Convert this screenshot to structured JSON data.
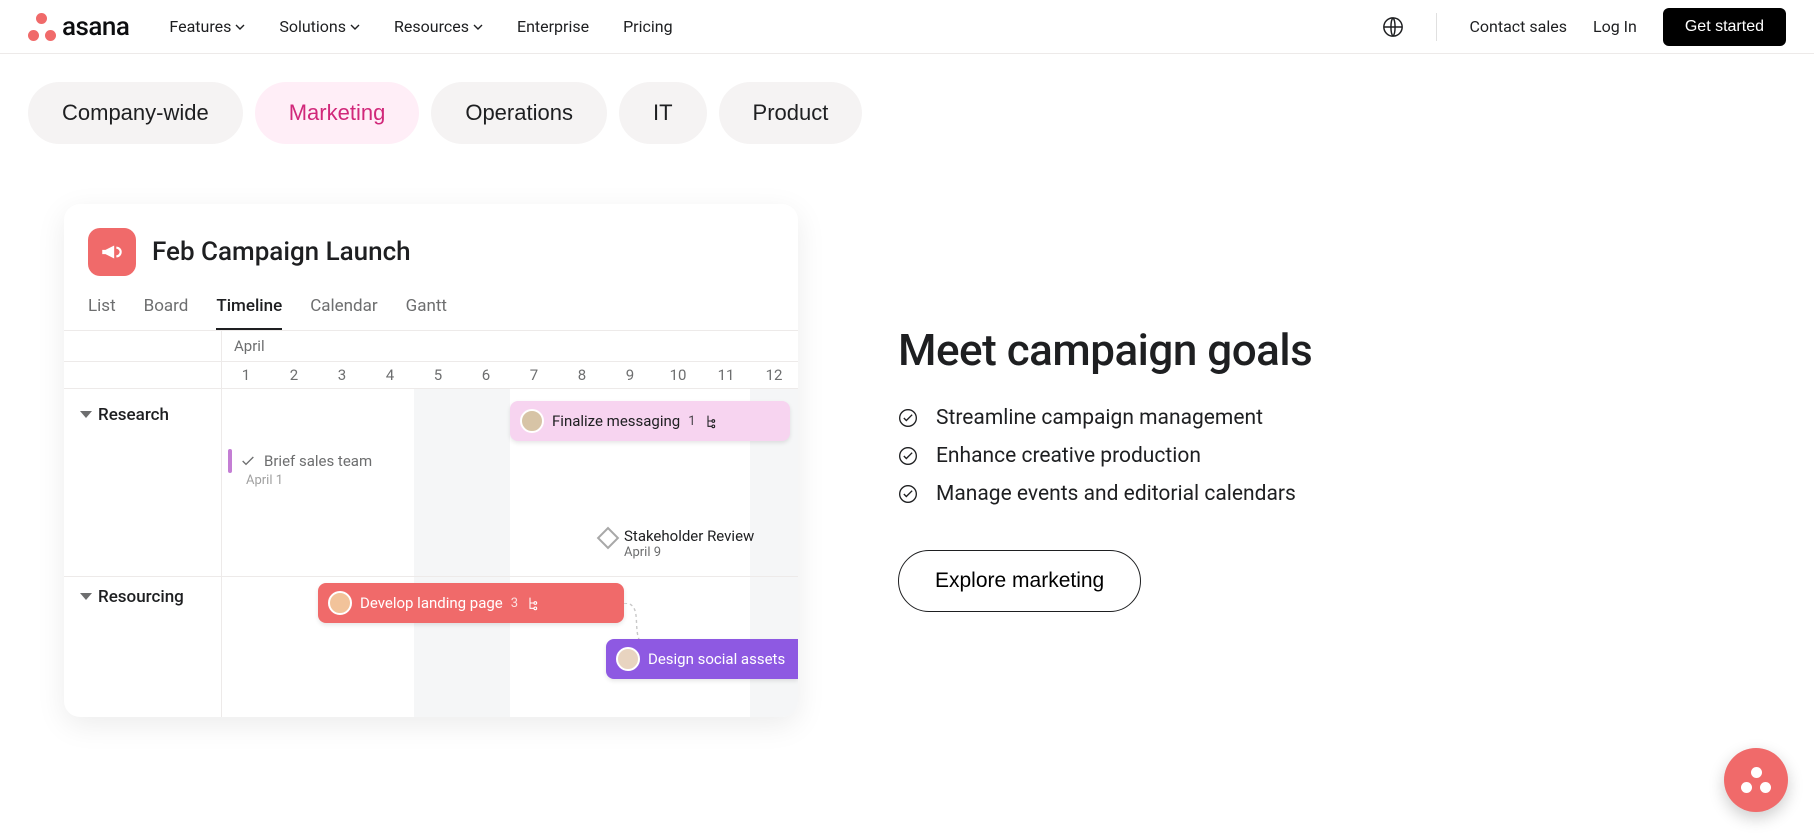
{
  "brand": {
    "name": "asana"
  },
  "nav": {
    "items": [
      {
        "label": "Features",
        "has_chevron": true
      },
      {
        "label": "Solutions",
        "has_chevron": true
      },
      {
        "label": "Resources",
        "has_chevron": true
      },
      {
        "label": "Enterprise",
        "has_chevron": false
      },
      {
        "label": "Pricing",
        "has_chevron": false
      }
    ],
    "contact_sales": "Contact sales",
    "log_in": "Log In",
    "get_started": "Get started"
  },
  "tabs": [
    {
      "label": "Company-wide",
      "active": false
    },
    {
      "label": "Marketing",
      "active": true
    },
    {
      "label": "Operations",
      "active": false
    },
    {
      "label": "IT",
      "active": false
    },
    {
      "label": "Product",
      "active": false
    }
  ],
  "card": {
    "title": "Feb Campaign Launch",
    "views": [
      {
        "label": "List",
        "active": false
      },
      {
        "label": "Board",
        "active": false
      },
      {
        "label": "Timeline",
        "active": true
      },
      {
        "label": "Calendar",
        "active": false
      },
      {
        "label": "Gantt",
        "active": false
      }
    ],
    "month": "April",
    "days": [
      "1",
      "2",
      "3",
      "4",
      "5",
      "6",
      "7",
      "8",
      "9",
      "10",
      "11",
      "12"
    ],
    "sections": [
      {
        "name": "Research",
        "expanded": true
      },
      {
        "name": "Resourcing",
        "expanded": true
      }
    ],
    "tasks": {
      "finalize": {
        "label": "Finalize messaging",
        "count": "1"
      },
      "brief": {
        "label": "Brief sales team",
        "date": "April 1"
      },
      "stakeholder": {
        "label": "Stakeholder Review",
        "date": "April 9"
      },
      "develop": {
        "label": "Develop landing page",
        "count": "3"
      },
      "design": {
        "label": "Design social assets"
      }
    }
  },
  "promo": {
    "headline": "Meet campaign goals",
    "bullets": [
      "Streamline campaign management",
      "Enhance creative production",
      "Manage events and editorial calendars"
    ],
    "cta": "Explore marketing"
  }
}
